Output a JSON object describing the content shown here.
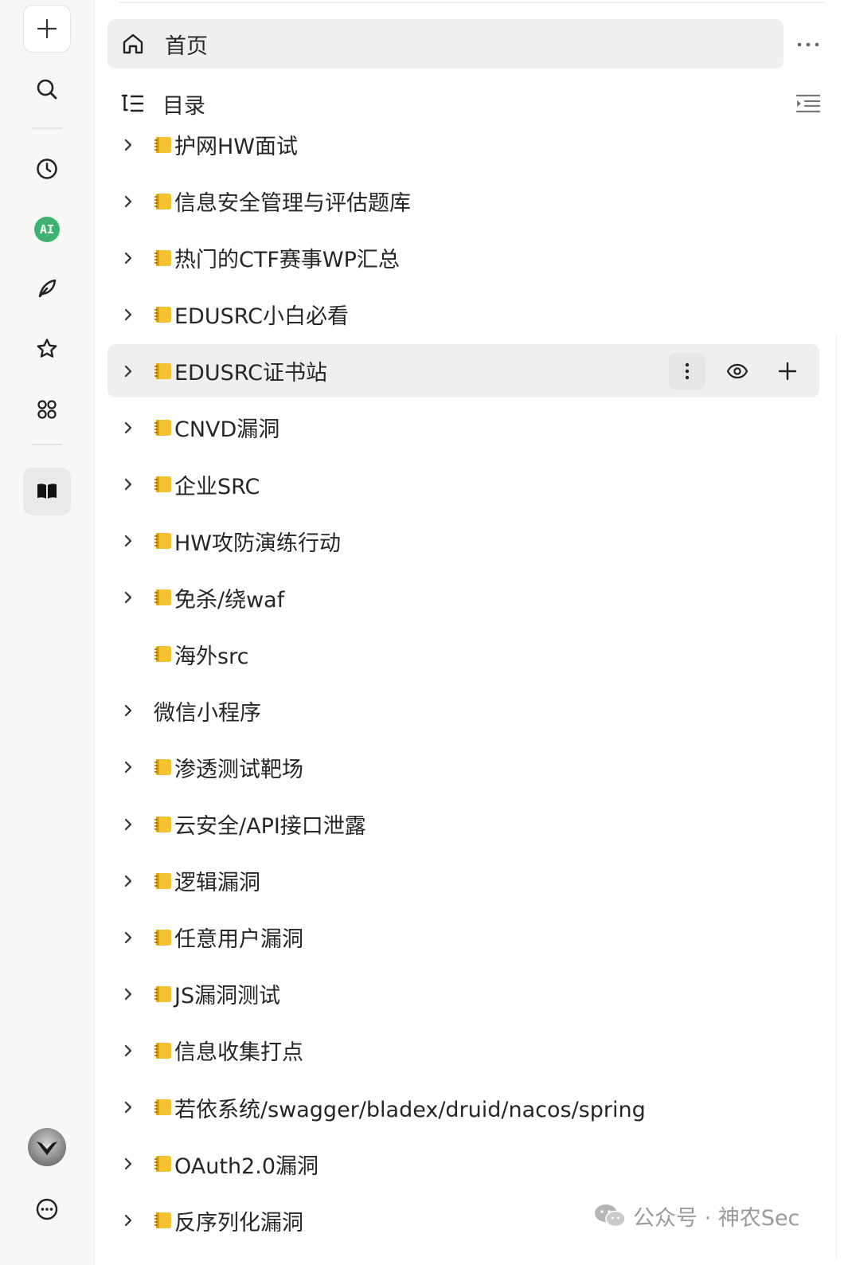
{
  "rail": {
    "new_icon": "plus-icon",
    "search_icon": "search-icon",
    "recent_icon": "clock-icon",
    "ai_label": "AI",
    "write_icon": "feather-icon",
    "favorites_icon": "star-icon",
    "apps_icon": "apps-grid-icon",
    "library_icon": "book-icon",
    "more_icon": "ellipsis-circle-icon"
  },
  "home": {
    "label": "首页"
  },
  "toc": {
    "label": "目录"
  },
  "tree": [
    {
      "label": "护网HW面试",
      "folder": true,
      "expandable": true
    },
    {
      "label": "信息安全管理与评估题库",
      "folder": true,
      "expandable": true
    },
    {
      "label": "热门的CTF赛事WP汇总",
      "folder": true,
      "expandable": true
    },
    {
      "label": "EDUSRC小白必看",
      "folder": true,
      "expandable": true
    },
    {
      "label": "EDUSRC证书站",
      "folder": true,
      "expandable": true,
      "hover": true
    },
    {
      "label": "CNVD漏洞",
      "folder": true,
      "expandable": true
    },
    {
      "label": "企业SRC",
      "folder": true,
      "expandable": true
    },
    {
      "label": "HW攻防演练行动",
      "folder": true,
      "expandable": true
    },
    {
      "label": "免杀/绕waf",
      "folder": true,
      "expandable": true
    },
    {
      "label": "海外src",
      "folder": true,
      "expandable": false
    },
    {
      "label": "微信小程序",
      "folder": false,
      "expandable": true
    },
    {
      "label": "渗透测试靶场",
      "folder": true,
      "expandable": true
    },
    {
      "label": "云安全/API接口泄露",
      "folder": true,
      "expandable": true
    },
    {
      "label": "逻辑漏洞",
      "folder": true,
      "expandable": true
    },
    {
      "label": "任意用户漏洞",
      "folder": true,
      "expandable": true
    },
    {
      "label": "JS漏洞测试",
      "folder": true,
      "expandable": true
    },
    {
      "label": "信息收集打点",
      "folder": true,
      "expandable": true
    },
    {
      "label": "若依系统/swagger/bladex/druid/nacos/spring",
      "folder": true,
      "expandable": true
    },
    {
      "label": "OAuth2.0漏洞",
      "folder": true,
      "expandable": true
    },
    {
      "label": "反序列化漏洞",
      "folder": true,
      "expandable": true
    }
  ],
  "watermark": {
    "text": "公众号 · 神农Sec"
  },
  "colors": {
    "hover_bg": "#efefef",
    "ai_green": "#3cb371",
    "folder_yellow": "#f2c230"
  }
}
